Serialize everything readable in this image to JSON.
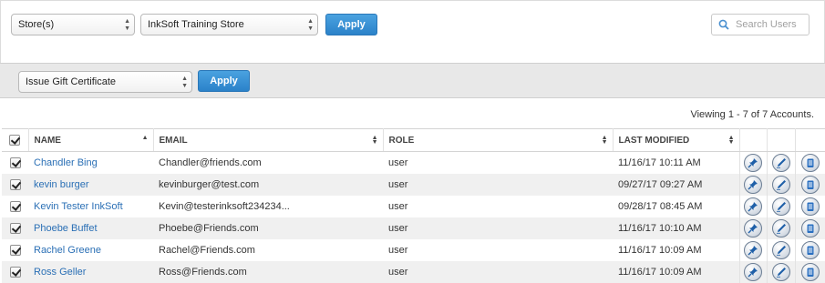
{
  "filters": {
    "store_scope": "Store(s)",
    "store_name": "InkSoft Training Store",
    "apply_label": "Apply",
    "search_placeholder": "Search Users"
  },
  "bulk": {
    "action": "Issue Gift Certificate",
    "apply_label": "Apply"
  },
  "viewing": "Viewing 1 - 7 of 7 Accounts.",
  "table": {
    "headers": {
      "name": "NAME",
      "email": "EMAIL",
      "role": "ROLE",
      "modified": "LAST MODIFIED"
    },
    "rows": [
      {
        "name": "Chandler  Bing",
        "email": "Chandler@friends.com",
        "role": "user",
        "modified": "11/16/17 10:11 AM"
      },
      {
        "name": "kevin burger",
        "email": "kevinburger@test.com",
        "role": "user",
        "modified": "09/27/17 09:27 AM"
      },
      {
        "name": "Kevin Tester InkSoft",
        "email": "Kevin@testerinksoft234234...",
        "role": "user",
        "modified": "09/28/17 08:45 AM"
      },
      {
        "name": "Phoebe Buffet",
        "email": "Phoebe@Friends.com",
        "role": "user",
        "modified": "11/16/17 10:10 AM"
      },
      {
        "name": "Rachel  Greene",
        "email": "Rachel@Friends.com",
        "role": "user",
        "modified": "11/16/17 10:09 AM"
      },
      {
        "name": "Ross Geller",
        "email": "Ross@Friends.com",
        "role": "user",
        "modified": "11/16/17 10:09 AM"
      }
    ]
  },
  "colors": {
    "accent": "#2b82c9",
    "link": "#2a6fb5",
    "stripe": "#f0f0f0",
    "bar": "#e8e8e8"
  },
  "icons": {
    "row_actions": [
      "pin-icon",
      "edit-pencil-icon",
      "notepad-icon"
    ],
    "search": "search-icon"
  }
}
